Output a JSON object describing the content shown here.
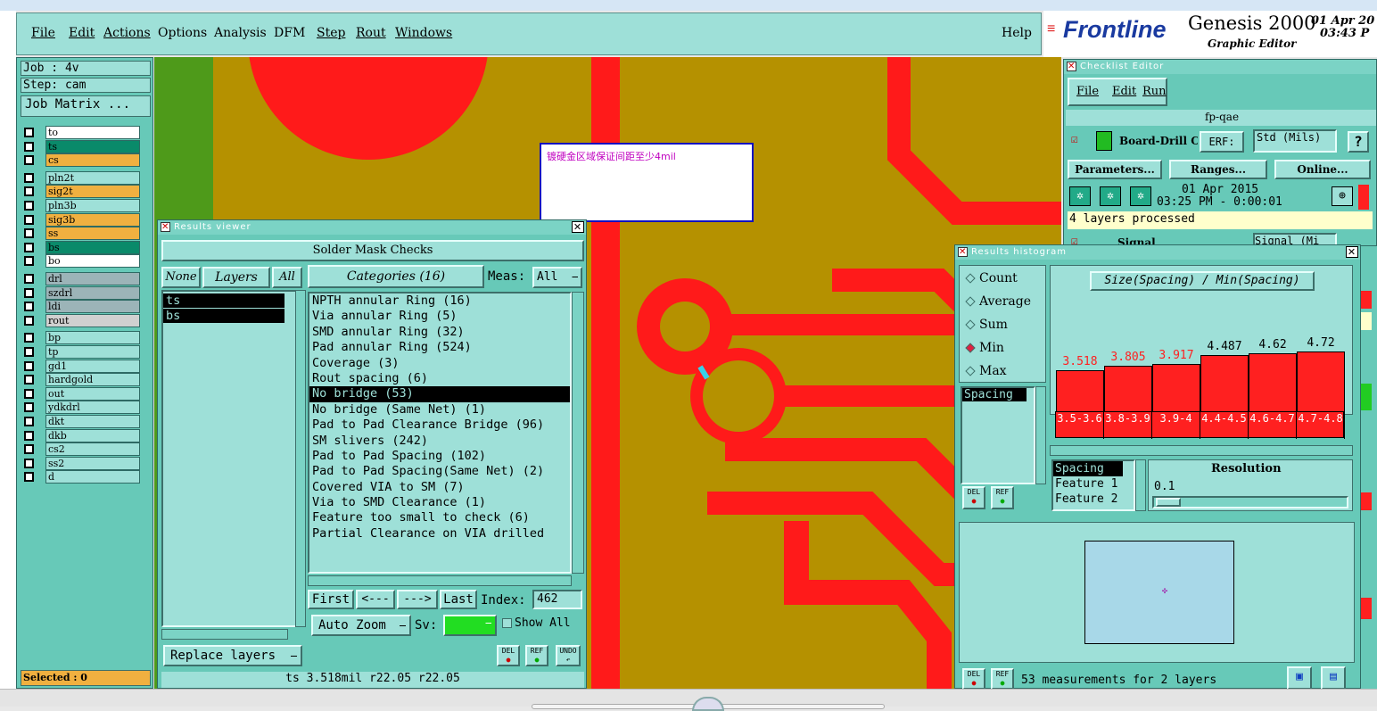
{
  "menubar": {
    "items": [
      "File",
      "Edit",
      "Actions",
      "Options",
      "Analysis",
      "DFM",
      "Step",
      "Rout",
      "Windows"
    ],
    "help": "Help",
    "brand": "Frontline",
    "product": "Genesis 2000",
    "product_sub": "Graphic Editor",
    "date": "01 Apr 20",
    "time": "03:43 P"
  },
  "left_panel": {
    "job": "Job : 4v",
    "step": "Step: cam",
    "job_matrix": "Job Matrix ...",
    "layers": [
      {
        "name": "to",
        "bg": "#ffffff"
      },
      {
        "name": "ts",
        "bg": "#0a8a6a"
      },
      {
        "name": "cs",
        "bg": "#f0b040"
      },
      {
        "name": "pln2t",
        "bg": "#9ee0d8"
      },
      {
        "name": "sig2t",
        "bg": "#f0b040"
      },
      {
        "name": "pln3b",
        "bg": "#9ee0d8"
      },
      {
        "name": "sig3b",
        "bg": "#f0b040"
      },
      {
        "name": "ss",
        "bg": "#f0b040"
      },
      {
        "name": "bs",
        "bg": "#0a8a6a"
      },
      {
        "name": "bo",
        "bg": "#ffffff"
      },
      {
        "name": "drl",
        "bg": "#9cb4b8"
      },
      {
        "name": "szdrl",
        "bg": "#9cb4b8"
      },
      {
        "name": "ldi",
        "bg": "#9cb4b8"
      },
      {
        "name": "rout",
        "bg": "#d0d0d0"
      },
      {
        "name": "bp",
        "bg": "#9ee0d8"
      },
      {
        "name": "tp",
        "bg": "#9ee0d8"
      },
      {
        "name": "gd1",
        "bg": "#9ee0d8"
      },
      {
        "name": "hardgold",
        "bg": "#9ee0d8"
      },
      {
        "name": "out",
        "bg": "#9ee0d8"
      },
      {
        "name": "ydkdrl",
        "bg": "#9ee0d8"
      },
      {
        "name": "dkt",
        "bg": "#9ee0d8"
      },
      {
        "name": "dkb",
        "bg": "#9ee0d8"
      },
      {
        "name": "cs2",
        "bg": "#9ee0d8"
      },
      {
        "name": "ss2",
        "bg": "#9ee0d8"
      },
      {
        "name": "d",
        "bg": "#9ee0d8"
      }
    ],
    "selected": "Selected : 0"
  },
  "canvas": {
    "note_text": "镀硬金区域保证间距至少4mil"
  },
  "results_viewer": {
    "title": "Results viewer",
    "header": "Solder Mask Checks",
    "none_btn": "None",
    "layers_btn": "Layers",
    "all_btn": "All",
    "categories_btn": "Categories (16)",
    "meas_label": "Meas:",
    "meas_value": "All",
    "layers": [
      "ts",
      "bs"
    ],
    "categories": [
      "NPTH annular Ring (16)",
      "Via annular Ring (5)",
      "SMD annular Ring (32)",
      "Pad annular Ring (524)",
      "Coverage (3)",
      "Rout spacing (6)",
      "No bridge (53)",
      "No bridge (Same Net) (1)",
      "Pad to Pad Clearance Bridge (96)",
      "SM slivers (242)",
      "Pad to Pad Spacing (102)",
      "Pad to Pad Spacing(Same Net) (2)",
      "Covered VIA to SM (7)",
      "Via to SMD Clearance (1)",
      "Feature too small to check (6)",
      "Partial Clearance on VIA drilled"
    ],
    "selected_category_index": 6,
    "first": "First",
    "prev": "<---",
    "next": "--->",
    "last": "Last",
    "index_label": "Index:",
    "index_value": "462",
    "auto_zoom": "Auto Zoom",
    "sv_label": "Sv:",
    "show_all": "Show All",
    "replace_layers": "Replace layers",
    "status": "ts 3.518mil  r22.05  r22.05",
    "del": "DEL",
    "ref": "REF",
    "undo": "UNDO"
  },
  "checklist": {
    "title": "Checklist Editor",
    "menu": [
      "File",
      "Edit",
      "Run"
    ],
    "name": "fp-qae",
    "row1_label": "Board-Drill Che",
    "erf_label": "ERF:",
    "erf_value": "Std (Mils)",
    "help": "?",
    "params": "Parameters...",
    "ranges": "Ranges...",
    "online": "Online...",
    "run_date": "01 Apr 2015",
    "run_time": "03:25 PM - 0:00:01",
    "processed": "4 layers processed",
    "row2_label": "Signal",
    "row2_erf": "Signal (Mi"
  },
  "histogram": {
    "title": "Results histogram",
    "options": [
      "Count",
      "Average",
      "Sum",
      "Min",
      "Max"
    ],
    "selected_option": "Min",
    "header": "Size(Spacing) / Min(Spacing)",
    "list_left": [
      "Spacing"
    ],
    "bins": [
      "3.5-3.6",
      "3.8-3.9",
      "3.9-4",
      "4.4-4.5",
      "4.6-4.7",
      "4.7-4.8"
    ],
    "values": [
      3.518,
      3.805,
      3.917,
      4.487,
      4.62,
      4.72
    ],
    "value_labels": [
      "3.518",
      "3.805",
      "3.917",
      "4.487",
      "4.62",
      "4.72"
    ],
    "value_colors": [
      "#ff2020",
      "#ff2020",
      "#ff2020",
      "#000000",
      "#000000",
      "#000000"
    ],
    "fields": [
      "Spacing",
      "Feature 1",
      "Feature 2"
    ],
    "resolution_label": "Resolution",
    "resolution_value": "0.1",
    "status": "53 measurements for 2 layers",
    "del": "DEL",
    "ref": "REF"
  },
  "colors": {
    "panel": "#9ee0d8",
    "copper": "#ff1a1a",
    "board": "#b59100",
    "green_edge": "#4e9a1a"
  }
}
